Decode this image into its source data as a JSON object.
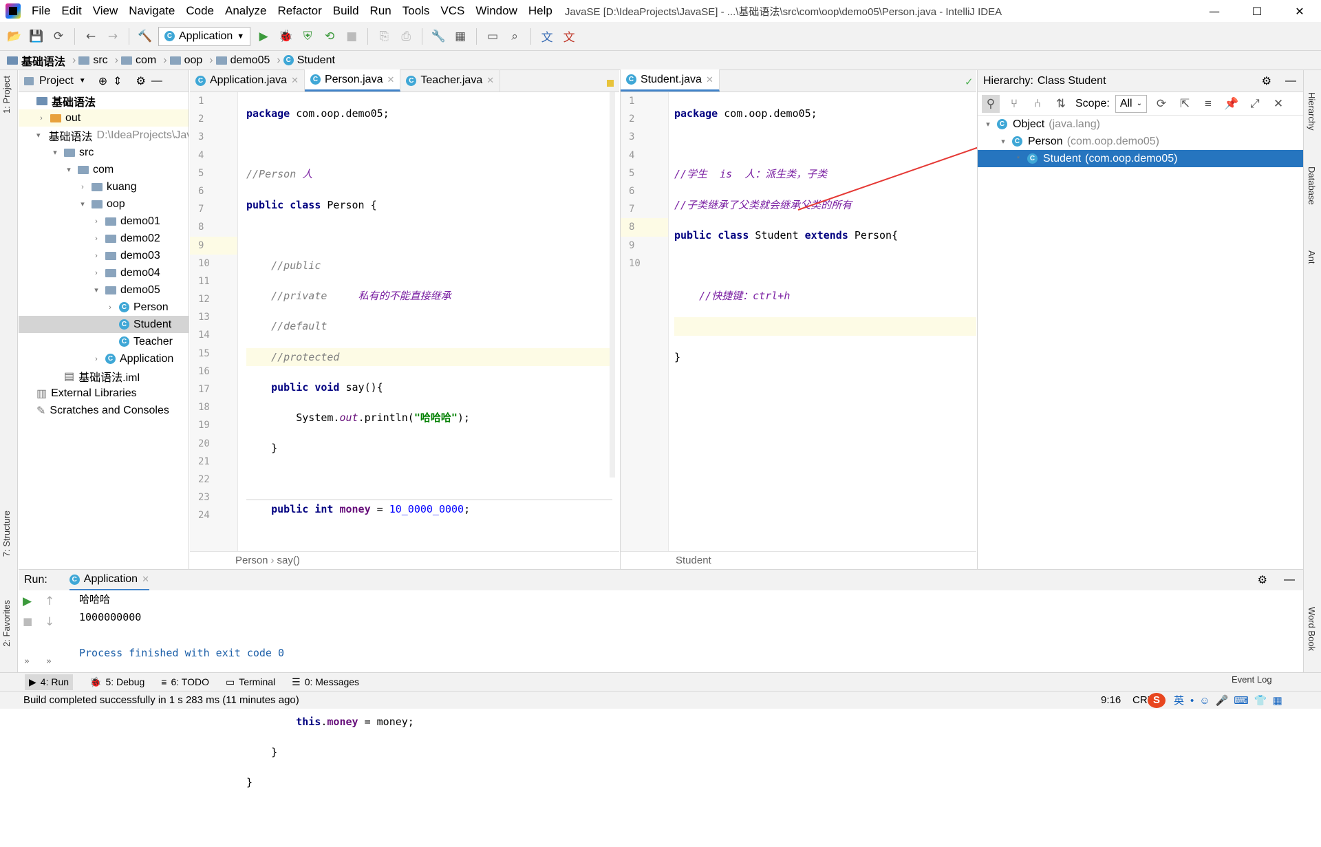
{
  "window": {
    "title": "JavaSE [D:\\IdeaProjects\\JavaSE] - ...\\基础语法\\src\\com\\oop\\demo05\\Person.java - IntelliJ IDEA",
    "controls": [
      "—",
      "☐",
      "✕"
    ]
  },
  "menu": [
    "File",
    "Edit",
    "View",
    "Navigate",
    "Code",
    "Analyze",
    "Refactor",
    "Build",
    "Run",
    "Tools",
    "VCS",
    "Window",
    "Help"
  ],
  "toolbar": {
    "run_config": "Application"
  },
  "breadcrumb": [
    "基础语法",
    "src",
    "com",
    "oop",
    "demo05",
    "Student"
  ],
  "project": {
    "header": "Project",
    "tree": [
      {
        "label": "基础语法",
        "depth": 0,
        "kind": "module-bold"
      },
      {
        "label": "out",
        "depth": 1,
        "kind": "folder-orange",
        "chev": "›",
        "hl": true
      },
      {
        "label": "基础语法",
        "extra": "D:\\IdeaProjects\\JavaSE",
        "depth": 1,
        "kind": "module",
        "chev": "⌄"
      },
      {
        "label": "src",
        "depth": 2,
        "kind": "folder",
        "chev": "⌄"
      },
      {
        "label": "com",
        "depth": 3,
        "kind": "folder",
        "chev": "⌄"
      },
      {
        "label": "kuang",
        "depth": 4,
        "kind": "folder",
        "chev": "›"
      },
      {
        "label": "oop",
        "depth": 4,
        "kind": "folder",
        "chev": "⌄"
      },
      {
        "label": "demo01",
        "depth": 5,
        "kind": "folder",
        "chev": "›"
      },
      {
        "label": "demo02",
        "depth": 5,
        "kind": "folder",
        "chev": "›"
      },
      {
        "label": "demo03",
        "depth": 5,
        "kind": "folder",
        "chev": "›"
      },
      {
        "label": "demo04",
        "depth": 5,
        "kind": "folder",
        "chev": "›"
      },
      {
        "label": "demo05",
        "depth": 5,
        "kind": "folder",
        "chev": "⌄"
      },
      {
        "label": "Person",
        "depth": 6,
        "kind": "class",
        "chev": "›"
      },
      {
        "label": "Student",
        "depth": 6,
        "kind": "class",
        "sel": true
      },
      {
        "label": "Teacher",
        "depth": 6,
        "kind": "class"
      },
      {
        "label": "Application",
        "depth": 5,
        "kind": "class",
        "chev": "›"
      },
      {
        "label": "基础语法.iml",
        "depth": 2,
        "kind": "iml"
      },
      {
        "label": "External Libraries",
        "depth": 0,
        "kind": "lib"
      },
      {
        "label": "Scratches and Consoles",
        "depth": 0,
        "kind": "scratch"
      }
    ]
  },
  "editor_left": {
    "tabs": [
      "Application.java",
      "Person.java",
      "Teacher.java"
    ],
    "active_tab": 1,
    "breadcrumb": [
      "Person",
      "say()"
    ],
    "lines": [
      "1",
      "2",
      "3",
      "4",
      "5",
      "6",
      "7",
      "8",
      "9",
      "10",
      "11",
      "12",
      "13",
      "14",
      "15",
      "16",
      "17",
      "18",
      "19",
      "20",
      "21",
      "22",
      "23",
      "24"
    ]
  },
  "editor_right": {
    "tabs": [
      "Student.java"
    ],
    "breadcrumb": [
      "Student"
    ],
    "lines": [
      "1",
      "2",
      "3",
      "4",
      "5",
      "6",
      "7",
      "8",
      "9",
      "10"
    ]
  },
  "hierarchy": {
    "title": "Hierarchy:",
    "subtitle": "Class Student",
    "scope_label": "Scope:",
    "scope_value": "All",
    "nodes": [
      {
        "name": "Object",
        "pkg": "(java.lang)",
        "depth": 0
      },
      {
        "name": "Person",
        "pkg": "(com.oop.demo05)",
        "depth": 1
      },
      {
        "name": "Student",
        "pkg": "(com.oop.demo05)",
        "depth": 2,
        "sel": true
      }
    ]
  },
  "run": {
    "label": "Run:",
    "tab": "Application",
    "output": [
      "哈哈哈",
      "1000000000",
      "",
      "Process finished with exit code 0"
    ]
  },
  "tool_tabs": [
    "4: Run",
    "5: Debug",
    "6: TODO",
    "Terminal",
    "0: Messages"
  ],
  "event_log": "Event Log",
  "status": {
    "message": "Build completed successfully in 1 s 283 ms (11 minutes ago)",
    "position": "9:16",
    "encoding": "CRL",
    "ime": "英"
  },
  "stripes": {
    "left": [
      "1: Project",
      "7: Structure",
      "2: Favorites"
    ],
    "right": [
      "Hierarchy",
      "Database",
      "Ant",
      "Word Book"
    ]
  },
  "colors": {
    "accent": "#2675bf",
    "keyword": "#000080",
    "comment": "#808080",
    "field": "#660e7a",
    "string": "#008000"
  }
}
